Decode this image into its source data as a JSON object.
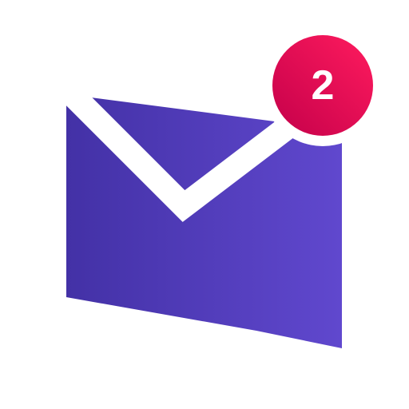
{
  "icon": {
    "name": "mail-icon",
    "colors": {
      "envelope_dark": "#4331A6",
      "envelope_light": "#6048CE",
      "flap_stroke": "#ffffff",
      "badge_dark": "#C4004A",
      "badge_light": "#FF1B5E",
      "badge_ring": "#ffffff"
    }
  },
  "badge": {
    "count": "2"
  }
}
